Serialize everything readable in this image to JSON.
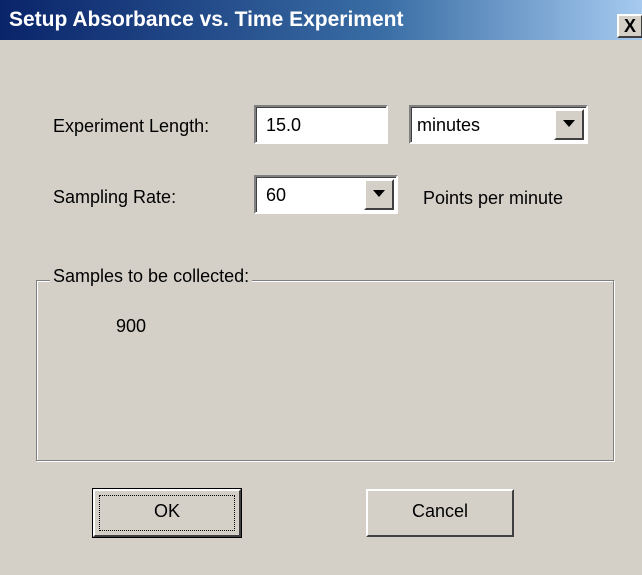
{
  "window": {
    "title": "Setup Absorbance vs. Time Experiment",
    "close_glyph": "X",
    "close_icon": "close-icon"
  },
  "form": {
    "experiment_length_label": "Experiment Length:",
    "experiment_length_value": "15.0",
    "units_selected": "minutes",
    "sampling_rate_label": "Sampling Rate:",
    "sampling_rate_selected": "60",
    "sampling_rate_units": "Points per minute"
  },
  "samples": {
    "caption": "Samples to be collected:",
    "value": "900"
  },
  "buttons": {
    "ok_label": "OK",
    "cancel_label": "Cancel"
  }
}
